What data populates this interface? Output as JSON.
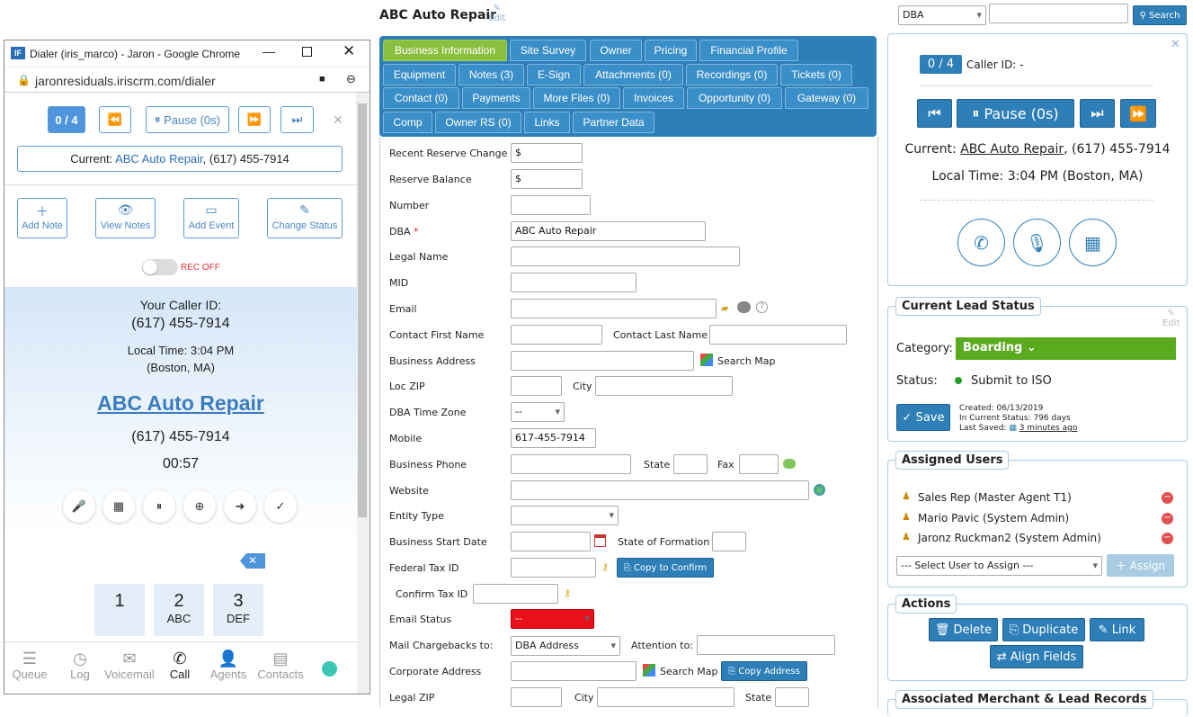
{
  "dialer": {
    "window_title": "Dialer (iris_marco) - Jaron - Google Chrome",
    "url": "jaronresiduals.iriscrm.com/dialer",
    "counter": "0 / 4",
    "pause_label": "Pause (0s)",
    "current_prefix": "Current:",
    "current_name": "ABC Auto Repair",
    "current_phone": ", (617) 455-7914",
    "actions": [
      "Add Note",
      "View Notes",
      "Add Event",
      "Change Status"
    ],
    "rec_label": "REC OFF",
    "caller_id_label": "Your Caller ID:",
    "caller_id": "(617) 455-7914",
    "local_time": "Local Time: 3:04 PM",
    "location": "(Boston, MA)",
    "business": "ABC Auto Repair",
    "phone": "(617) 455-7914",
    "timer": "00:57",
    "keys": [
      {
        "n": "1",
        "l": ""
      },
      {
        "n": "2",
        "l": "ABC"
      },
      {
        "n": "3",
        "l": "DEF"
      }
    ],
    "nav": [
      "Queue",
      "Log",
      "Voicemail",
      "Call",
      "Agents",
      "Contacts"
    ]
  },
  "header": {
    "title": "ABC Auto Repair",
    "edit": "Edit",
    "search_select": "DBA",
    "search_button": "Search",
    "search_value": ""
  },
  "tabs": [
    "Business Information",
    "Site Survey",
    "Owner",
    "Pricing",
    "Financial Profile",
    "Equipment",
    "Notes (3)",
    "E-Sign",
    "Attachments (0)",
    "Recordings (0)",
    "Tickets (0)",
    "Contact (0)",
    "Payments",
    "More Files (0)",
    "Invoices",
    "Opportunity (0)",
    "Gateway (0)",
    "Comp",
    "Owner RS (0)",
    "Links",
    "Partner Data"
  ],
  "form": {
    "recent_reserve_change": "Recent Reserve Change",
    "recent_reserve_value": "$",
    "reserve_balance": "Reserve Balance",
    "reserve_balance_value": "$",
    "number": "Number",
    "dba": "DBA",
    "dba_value": "ABC Auto Repair",
    "legal_name": "Legal Name",
    "mid": "MID",
    "email": "Email",
    "contact_first": "Contact First Name",
    "contact_last": "Contact Last Name",
    "business_address": "Business Address",
    "search_map": "Search Map",
    "loc_zip": "Loc ZIP",
    "city": "City",
    "dba_time_zone": "DBA Time Zone",
    "tz_value": "--",
    "mobile": "Mobile",
    "mobile_value": "617-455-7914",
    "business_phone": "Business Phone",
    "state": "State",
    "fax": "Fax",
    "website": "Website",
    "entity_type": "Entity Type",
    "business_start_date": "Business Start Date",
    "state_of_formation": "State of Formation",
    "federal_tax_id": "Federal Tax ID",
    "copy_to_confirm": "Copy to Confirm",
    "confirm_tax_id": "Confirm Tax ID",
    "email_status": "Email Status",
    "email_status_value": "--",
    "mail_chargebacks": "Mail Chargebacks to:",
    "mail_chargebacks_value": "DBA Address",
    "attention_to": "Attention to:",
    "corporate_address": "Corporate Address",
    "copy_address": "Copy Address",
    "legal_zip": "Legal ZIP"
  },
  "call_panel": {
    "counter": "0 / 4",
    "caller_id": "Caller ID: -",
    "pause": "Pause (0s)",
    "current_prefix": "Current:",
    "current_name": "ABC Auto Repair",
    "current_phone": ", (617) 455-7914",
    "local_time": "Local Time: 3:04 PM (Boston, MA)"
  },
  "lead_status": {
    "title": "Current Lead Status",
    "edit": "Edit",
    "category_label": "Category:",
    "category": "Boarding",
    "status_label": "Status:",
    "status": "Submit to ISO",
    "save": "Save",
    "created": "Created: 06/13/2019",
    "in_status": "In Current Status: 796 days",
    "last_saved_label": "Last Saved:",
    "last_saved": "3 minutes ago",
    "category_color": "#5aaa1e",
    "status_color": "#2a9a2a"
  },
  "assigned": {
    "title": "Assigned Users",
    "users": [
      "Sales Rep (Master Agent T1)",
      "Mario Pavic (System Admin)",
      "Jaronz Ruckman2 (System Admin)"
    ],
    "select_placeholder": "--- Select User to Assign ---",
    "assign": "Assign"
  },
  "actions": {
    "title": "Actions",
    "delete": "Delete",
    "duplicate": "Duplicate",
    "link": "Link",
    "align": "Align Fields"
  },
  "associated": {
    "title": "Associated Merchant & Lead Records"
  }
}
